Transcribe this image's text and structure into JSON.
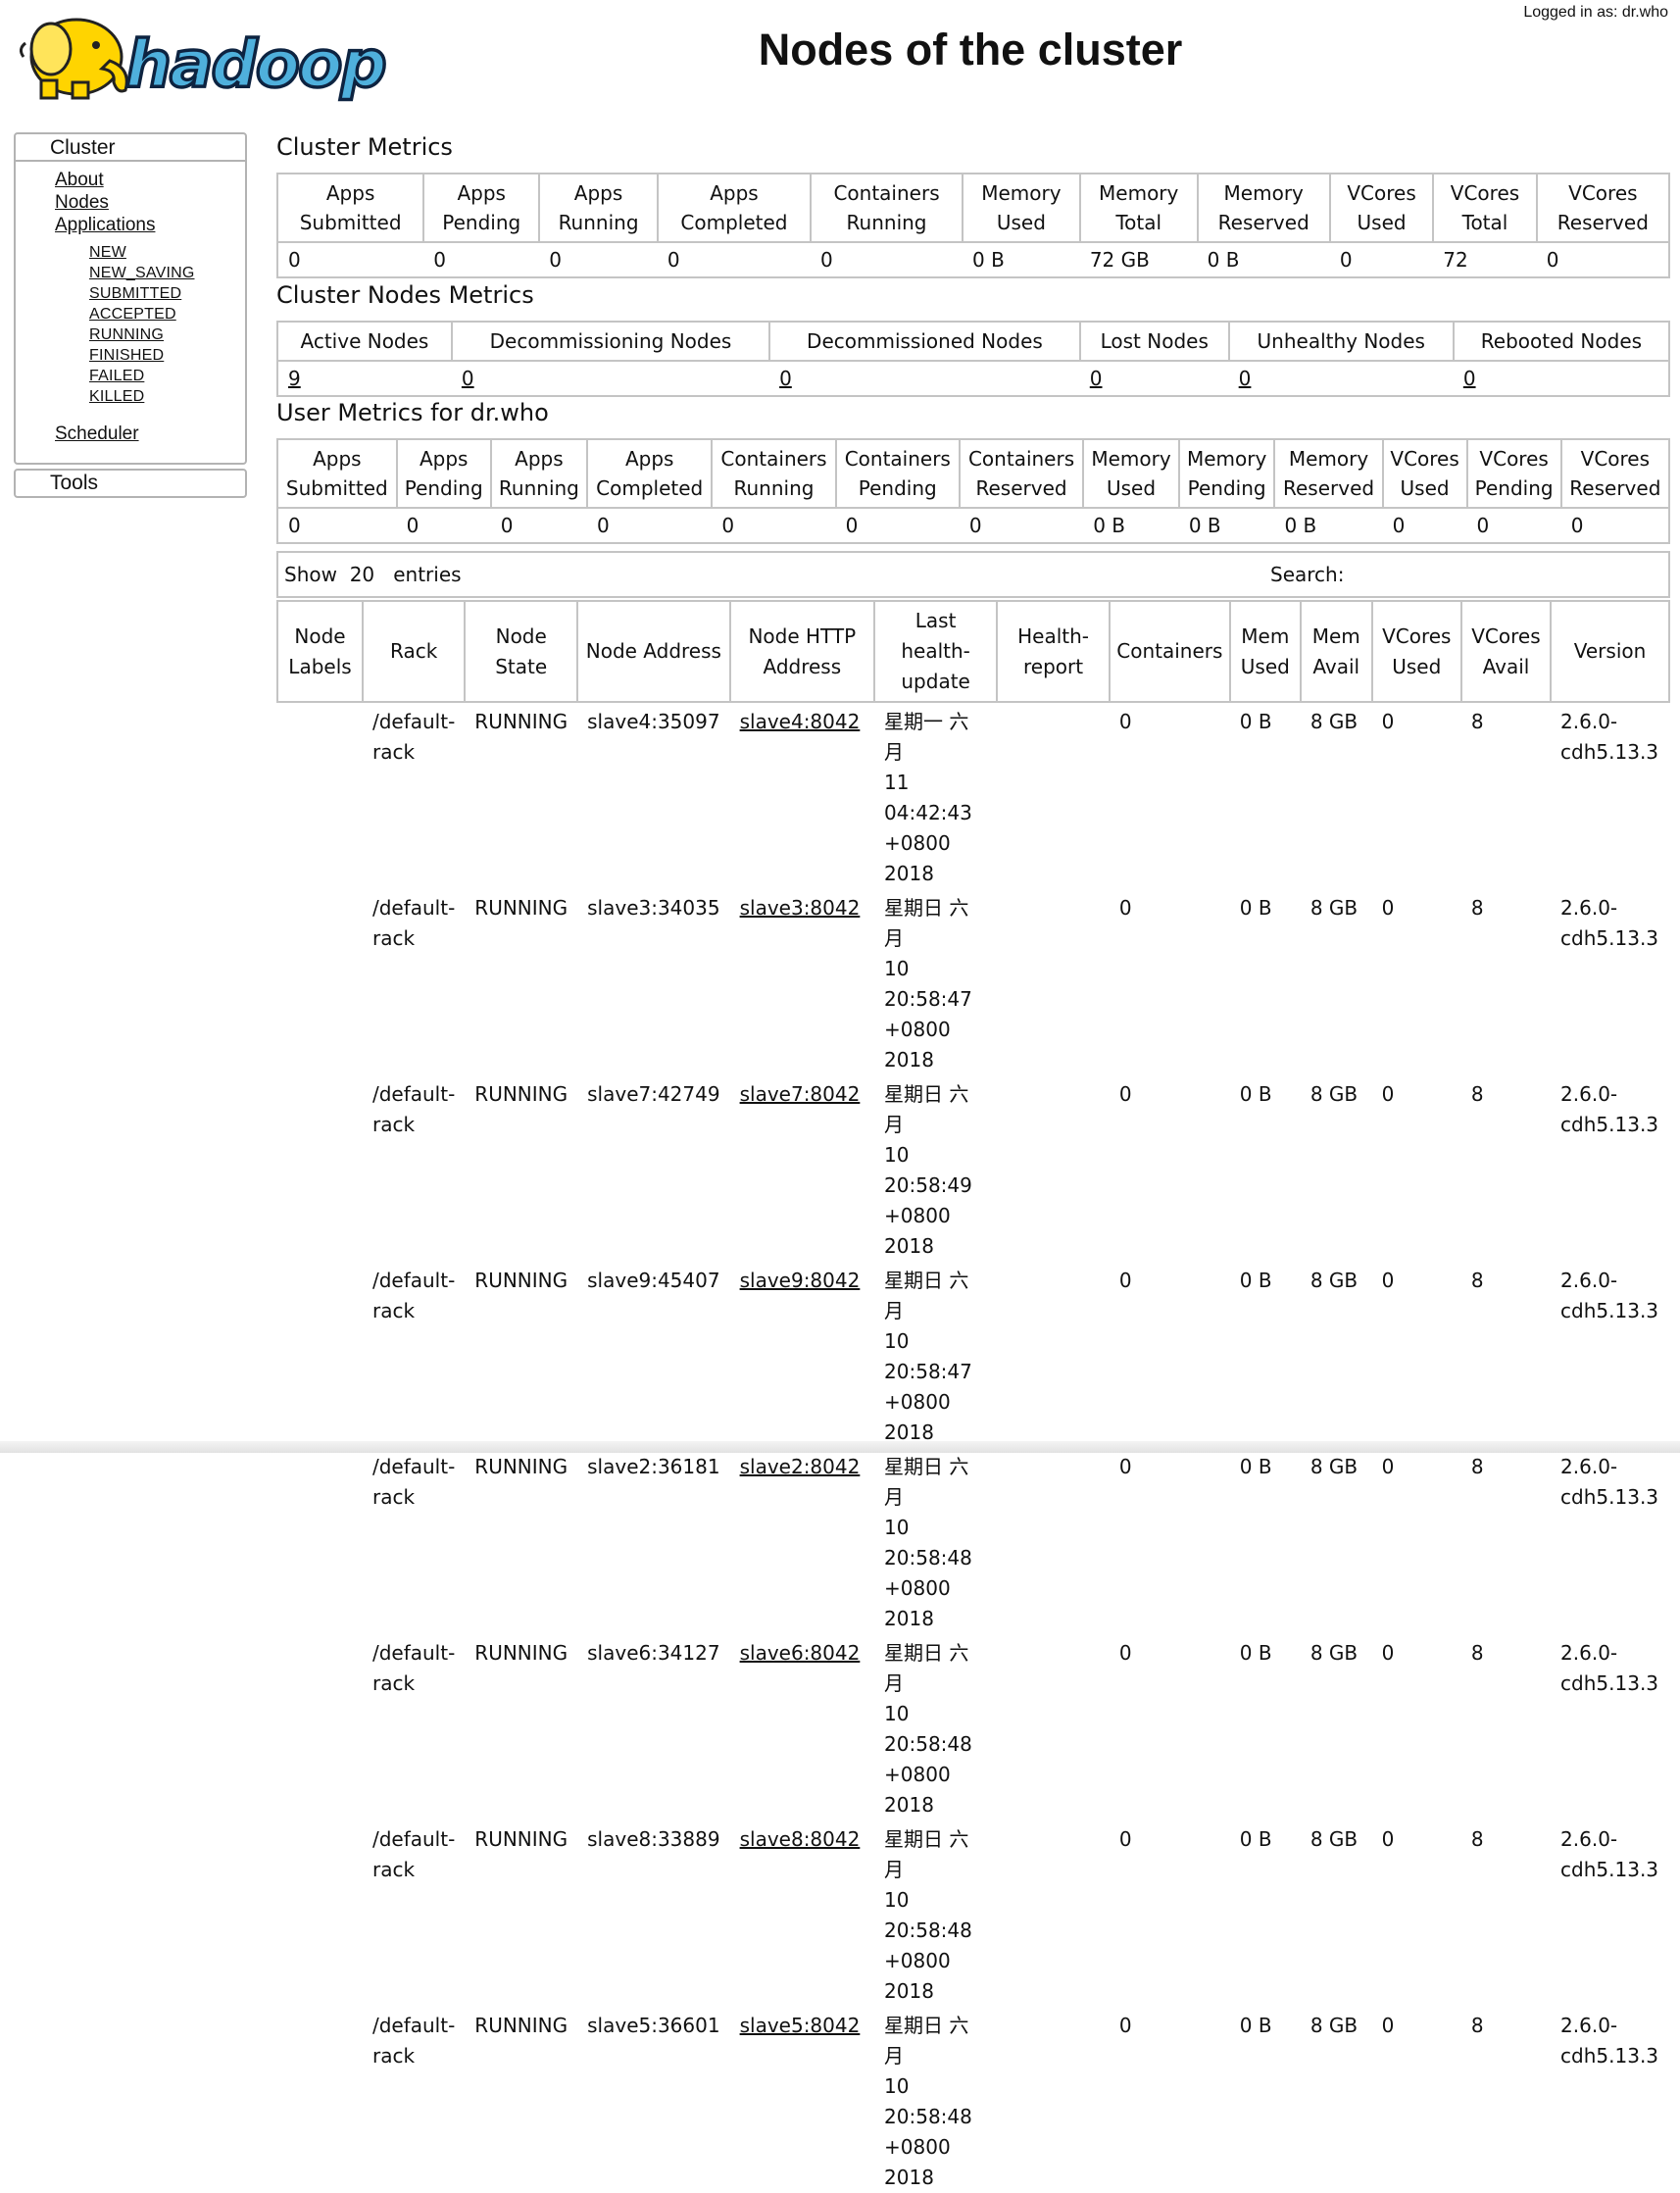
{
  "header": {
    "title": "Nodes of the cluster",
    "logged_in": "Logged in as: dr.who",
    "logo_text": "hadoop"
  },
  "sidebar": {
    "cluster_label": "Cluster",
    "links": [
      "About",
      "Nodes",
      "Applications"
    ],
    "app_states": [
      "NEW",
      "NEW_SAVING",
      "SUBMITTED",
      "ACCEPTED",
      "RUNNING",
      "FINISHED",
      "FAILED",
      "KILLED"
    ],
    "scheduler": "Scheduler",
    "tools_label": "Tools"
  },
  "cluster_metrics": {
    "title": "Cluster Metrics",
    "headers": [
      [
        "Apps",
        "Submitted"
      ],
      [
        "Apps",
        "Pending"
      ],
      [
        "Apps",
        "Running"
      ],
      [
        "Apps",
        "Completed"
      ],
      [
        "Containers",
        "Running"
      ],
      [
        "Memory",
        "Used"
      ],
      [
        "Memory",
        "Total"
      ],
      [
        "Memory",
        "Reserved"
      ],
      [
        "VCores",
        "Used"
      ],
      [
        "VCores",
        "Total"
      ],
      [
        "VCores",
        "Reserved"
      ]
    ],
    "values": [
      "0",
      "0",
      "0",
      "0",
      "0",
      "0 B",
      "72 GB",
      "0 B",
      "0",
      "72",
      "0"
    ]
  },
  "node_metrics": {
    "title": "Cluster Nodes Metrics",
    "headers": [
      "Active Nodes",
      "Decommissioning Nodes",
      "Decommissioned Nodes",
      "Lost Nodes",
      "Unhealthy Nodes",
      "Rebooted Nodes"
    ],
    "values": [
      "9",
      "0",
      "0",
      "0",
      "0",
      "0"
    ]
  },
  "user_metrics": {
    "title": "User Metrics for dr.who",
    "headers": [
      [
        "Apps",
        "Submitted"
      ],
      [
        "Apps",
        "Pending"
      ],
      [
        "Apps",
        "Running"
      ],
      [
        "Apps",
        "Completed"
      ],
      [
        "Containers",
        "Running"
      ],
      [
        "Containers",
        "Pending"
      ],
      [
        "Containers",
        "Reserved"
      ],
      [
        "Memory",
        "Used"
      ],
      [
        "Memory",
        "Pending"
      ],
      [
        "Memory",
        "Reserved"
      ],
      [
        "VCores",
        "Used"
      ],
      [
        "VCores",
        "Pending"
      ],
      [
        "VCores",
        "Reserved"
      ]
    ],
    "values": [
      "0",
      "0",
      "0",
      "0",
      "0",
      "0",
      "0",
      "0 B",
      "0 B",
      "0 B",
      "0",
      "0",
      "0"
    ]
  },
  "entries": {
    "show_label": "Show",
    "count": "20",
    "entries_label": "entries",
    "search_label": "Search:"
  },
  "nodes_table": {
    "headers": [
      [
        "Node",
        "Labels"
      ],
      [
        "Rack"
      ],
      [
        "Node",
        "State"
      ],
      [
        "Node Address"
      ],
      [
        "Node HTTP",
        "Address"
      ],
      [
        "Last",
        "health-",
        "update"
      ],
      [
        "Health-",
        "report"
      ],
      [
        "Containers"
      ],
      [
        "Mem",
        "Used"
      ],
      [
        "Mem",
        "Avail"
      ],
      [
        "VCores",
        "Used"
      ],
      [
        "VCores",
        "Avail"
      ],
      [
        "Version"
      ]
    ],
    "rows": [
      {
        "labels": "",
        "rack": [
          "/default-",
          "rack"
        ],
        "state": "RUNNING",
        "address": "slave4:35097",
        "http": "slave4:8042",
        "health_update": [
          "星期一 六月",
          "11 04:42:43",
          "+0800 2018"
        ],
        "health_report": "",
        "containers": "0",
        "mem_used": "0 B",
        "mem_avail": "8 GB",
        "vcores_used": "0",
        "vcores_avail": "8",
        "version": [
          "2.6.0-",
          "cdh5.13.3"
        ]
      },
      {
        "labels": "",
        "rack": [
          "/default-",
          "rack"
        ],
        "state": "RUNNING",
        "address": "slave3:34035",
        "http": "slave3:8042",
        "health_update": [
          "星期日 六月",
          "10 20:58:47",
          "+0800 2018"
        ],
        "health_report": "",
        "containers": "0",
        "mem_used": "0 B",
        "mem_avail": "8 GB",
        "vcores_used": "0",
        "vcores_avail": "8",
        "version": [
          "2.6.0-",
          "cdh5.13.3"
        ]
      },
      {
        "labels": "",
        "rack": [
          "/default-",
          "rack"
        ],
        "state": "RUNNING",
        "address": "slave7:42749",
        "http": "slave7:8042",
        "health_update": [
          "星期日 六月",
          "10 20:58:49",
          "+0800 2018"
        ],
        "health_report": "",
        "containers": "0",
        "mem_used": "0 B",
        "mem_avail": "8 GB",
        "vcores_used": "0",
        "vcores_avail": "8",
        "version": [
          "2.6.0-",
          "cdh5.13.3"
        ]
      },
      {
        "labels": "",
        "rack": [
          "/default-",
          "rack"
        ],
        "state": "RUNNING",
        "address": "slave9:45407",
        "http": "slave9:8042",
        "health_update": [
          "星期日 六月",
          "10 20:58:47",
          "+0800 2018"
        ],
        "health_report": "",
        "containers": "0",
        "mem_used": "0 B",
        "mem_avail": "8 GB",
        "vcores_used": "0",
        "vcores_avail": "8",
        "version": [
          "2.6.0-",
          "cdh5.13.3"
        ]
      },
      {
        "labels": "",
        "rack": [
          "/default-",
          "rack"
        ],
        "state": "RUNNING",
        "address": "slave2:36181",
        "http": "slave2:8042",
        "health_update": [
          "星期日 六月",
          "10 20:58:48",
          "+0800 2018"
        ],
        "health_report": "",
        "containers": "0",
        "mem_used": "0 B",
        "mem_avail": "8 GB",
        "vcores_used": "0",
        "vcores_avail": "8",
        "version": [
          "2.6.0-",
          "cdh5.13.3"
        ]
      },
      {
        "labels": "",
        "rack": [
          "/default-",
          "rack"
        ],
        "state": "RUNNING",
        "address": "slave6:34127",
        "http": "slave6:8042",
        "health_update": [
          "星期日 六月",
          "10 20:58:48",
          "+0800 2018"
        ],
        "health_report": "",
        "containers": "0",
        "mem_used": "0 B",
        "mem_avail": "8 GB",
        "vcores_used": "0",
        "vcores_avail": "8",
        "version": [
          "2.6.0-",
          "cdh5.13.3"
        ]
      },
      {
        "labels": "",
        "rack": [
          "/default-",
          "rack"
        ],
        "state": "RUNNING",
        "address": "slave8:33889",
        "http": "slave8:8042",
        "health_update": [
          "星期日 六月",
          "10 20:58:48",
          "+0800 2018"
        ],
        "health_report": "",
        "containers": "0",
        "mem_used": "0 B",
        "mem_avail": "8 GB",
        "vcores_used": "0",
        "vcores_avail": "8",
        "version": [
          "2.6.0-",
          "cdh5.13.3"
        ]
      },
      {
        "labels": "",
        "rack": [
          "/default-",
          "rack"
        ],
        "state": "RUNNING",
        "address": "slave5:36601",
        "http": "slave5:8042",
        "health_update": [
          "星期日 六月",
          "10 20:58:48",
          "+0800 2018"
        ],
        "health_report": "",
        "containers": "0",
        "mem_used": "0 B",
        "mem_avail": "8 GB",
        "vcores_used": "0",
        "vcores_avail": "8",
        "version": [
          "2.6.0-",
          "cdh5.13.3"
        ]
      }
    ]
  },
  "colors": {
    "logo_yellow": "#ffd400",
    "logo_blue": "#4fb0dc",
    "border_gray": "#c4c4c4"
  }
}
